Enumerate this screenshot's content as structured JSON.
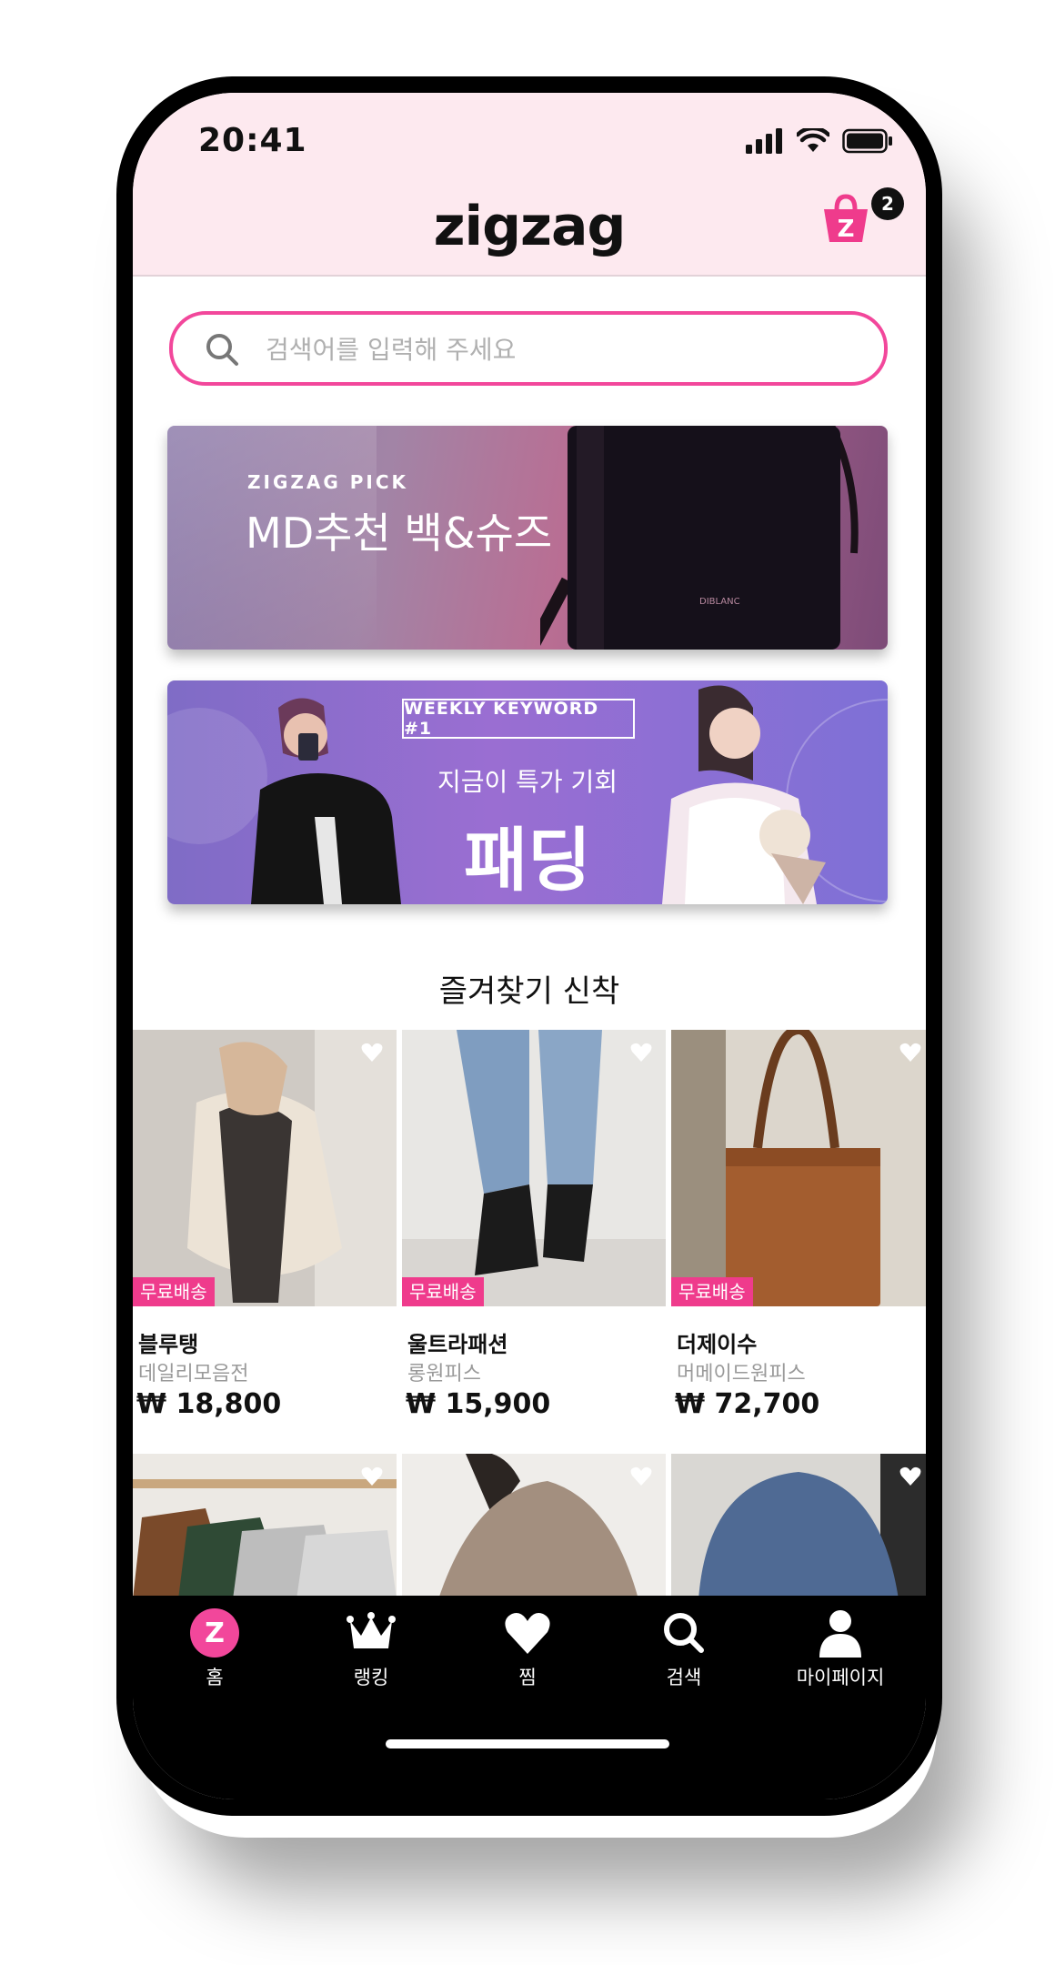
{
  "status_bar": {
    "time": "20:41"
  },
  "header": {
    "logo": "zigzag",
    "cart_count": "2",
    "cart_letter": "Z"
  },
  "search": {
    "placeholder": "검색어를 입력해 주세요"
  },
  "banners": [
    {
      "eyebrow": "ZIGZAG PICK",
      "title": "MD추천 백&슈즈",
      "bag_brand": "DIBLANC"
    },
    {
      "keyword": "WEEKLY KEYWORD #1",
      "subtitle": "지금이 특가 기회",
      "title": "패딩"
    }
  ],
  "section": {
    "title": "즐겨찾기 신착"
  },
  "products": [
    {
      "badge": "무료배송",
      "shop": "블루탱",
      "category": "데일리모음전",
      "price": "₩ 18,800"
    },
    {
      "badge": "무료배송",
      "shop": "울트라패션",
      "category": "롱원피스",
      "price": "₩ 15,900"
    },
    {
      "badge": "무료배송",
      "shop": "더제이수",
      "category": "머메이드원피스",
      "price": "₩ 72,700"
    }
  ],
  "nav": [
    {
      "label": "홈",
      "icon": "home-z-icon"
    },
    {
      "label": "랭킹",
      "icon": "crown-icon"
    },
    {
      "label": "찜",
      "icon": "heart-icon"
    },
    {
      "label": "검색",
      "icon": "search-icon"
    },
    {
      "label": "마이페이지",
      "icon": "profile-icon"
    }
  ],
  "colors": {
    "accent": "#f2479b",
    "header_bg": "#fde9ef",
    "badge": "#ef3b8c"
  }
}
